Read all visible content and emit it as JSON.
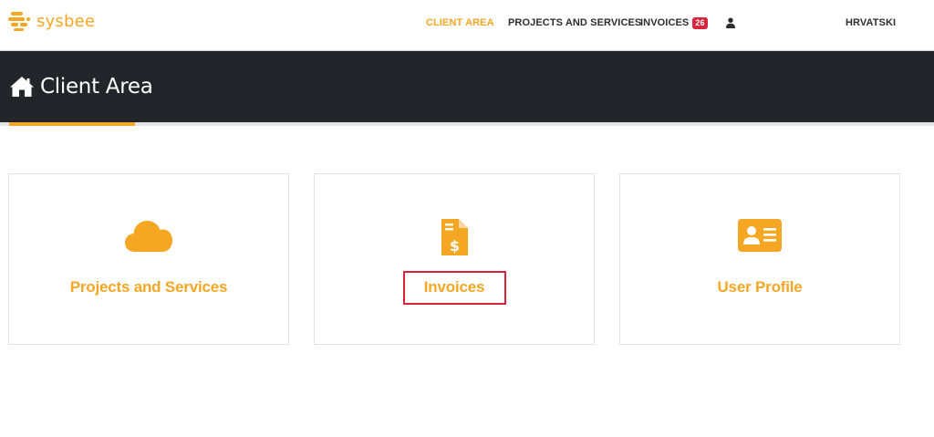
{
  "header": {
    "logo_text": "sysbee",
    "nav": {
      "client_area": "CLIENT AREA",
      "projects": "PROJECTS AND SERVICES",
      "invoices": "INVOICES",
      "invoices_badge": "26",
      "language": "HRVATSKI"
    }
  },
  "page": {
    "title": "Client Area"
  },
  "cards": [
    {
      "label": "Projects and Services",
      "icon": "cloud-icon"
    },
    {
      "label": "Invoices",
      "icon": "invoice-icon"
    },
    {
      "label": "User Profile",
      "icon": "id-card-icon"
    }
  ],
  "colors": {
    "accent": "#f5a623",
    "dark_band": "#22262a",
    "badge": "#d9243b"
  }
}
